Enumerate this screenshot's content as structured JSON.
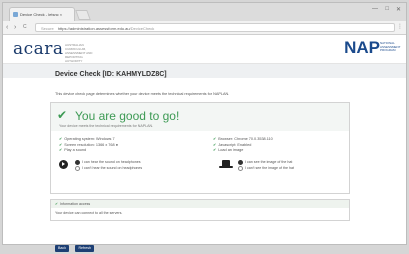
{
  "browser": {
    "tab_title": "Device Check - letsnc ×",
    "tab_close": "×",
    "new_tab": "",
    "window_min": "—",
    "window_max": "□",
    "window_close": "✕",
    "nav_back": "‹",
    "nav_forward": "›",
    "nav_reload": "C",
    "secure_label": "Secure",
    "url_host": "https://administration.assessform.edu.au",
    "url_path": "/DeviceCheck",
    "menu": "⋮"
  },
  "header": {
    "acara_logo": "acara",
    "acara_tagline": "AUSTRALIAN CURRICULUM, ASSESSMENT AND REPORTING AUTHORITY",
    "nap_logo": "NAP",
    "nap_tagline": "NATIONAL ASSESSMENT PROGRAM"
  },
  "page": {
    "title": "Device Check [ID: KAHMYLDZ8C]",
    "intro": "This device check page determines whether your device meets the technical requirements for NAPLAN."
  },
  "result": {
    "title": "You are good to go!",
    "subtitle": "Your device meets the technical requirements for NAPLAN."
  },
  "checks": {
    "os": "Operating system: Windows 7",
    "resolution": "Screen resolution: 1366 x 768",
    "sound": "Play a sound",
    "browser": "Browser: Chrome 70.0.3538.110",
    "javascript": "Javascript: Enabled",
    "image": "Load an image"
  },
  "sound_options": {
    "yes": "I can hear the sound on headphones",
    "no": "I can't hear the sound on headphones"
  },
  "image_options": {
    "yes": "I can see the image of the hat",
    "no": "I can't see the image of the hat"
  },
  "servers": {
    "heading": "Information access",
    "body": "Your device can connect to all the servers."
  },
  "buttons": {
    "back": "Back",
    "refresh": "Refresh"
  },
  "colors": {
    "accent_green": "#3d9a54",
    "brand_navy": "#1d3f74"
  }
}
